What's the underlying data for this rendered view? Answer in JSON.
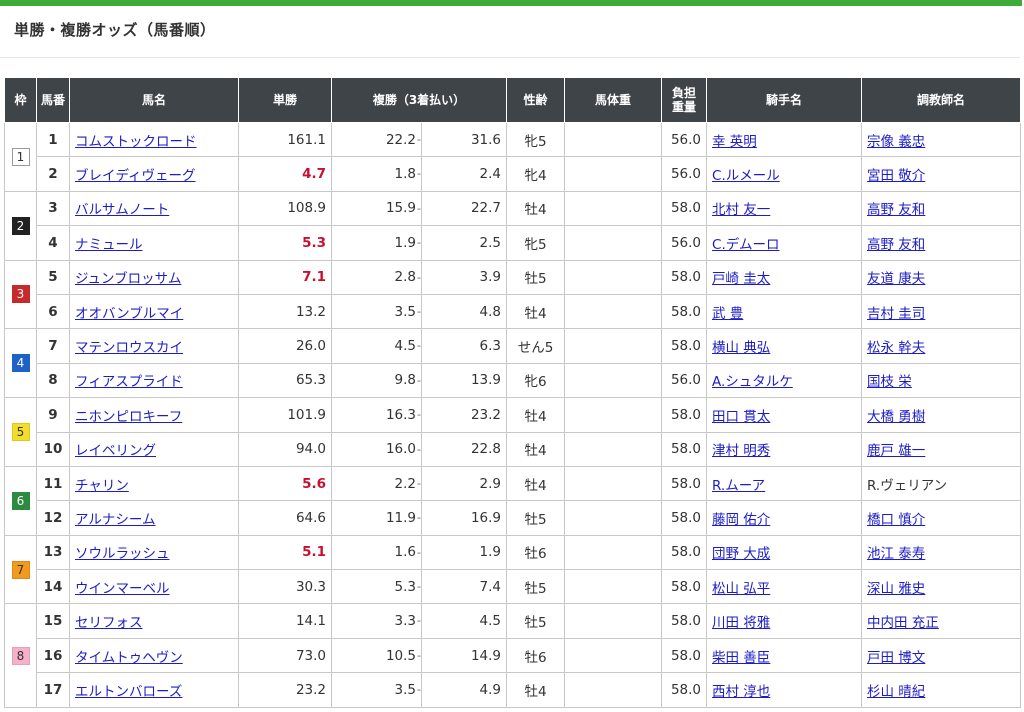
{
  "page": {
    "title": "単勝・複勝オッズ（馬番順）"
  },
  "colors": {
    "accent": "#3daa3a",
    "header_bg": "#3e4448",
    "link": "#1c1cc8",
    "popular": "#c8102e"
  },
  "headers": {
    "waku": "枠",
    "umaban": "馬番",
    "name": "馬名",
    "win": "単勝",
    "place": "複勝（3着払い）",
    "sex_age": "性齢",
    "body_weight": "馬体重",
    "carried_weight": "負担 重量",
    "jockey": "騎手名",
    "trainer": "調教師名"
  },
  "waku": [
    {
      "label": "1",
      "bg": "#ffffff",
      "fg": "#333333",
      "border": "#999999"
    },
    {
      "label": "2",
      "bg": "#222222",
      "fg": "#ffffff",
      "border": "#222222"
    },
    {
      "label": "3",
      "bg": "#c62a2a",
      "fg": "#ffffff",
      "border": "#c62a2a"
    },
    {
      "label": "4",
      "bg": "#1e62c8",
      "fg": "#ffffff",
      "border": "#1e62c8"
    },
    {
      "label": "5",
      "bg": "#f2dd2a",
      "fg": "#333333",
      "border": "#e0c820"
    },
    {
      "label": "6",
      "bg": "#2e8a3e",
      "fg": "#ffffff",
      "border": "#2e8a3e"
    },
    {
      "label": "7",
      "bg": "#f29a1e",
      "fg": "#333333",
      "border": "#e08a10"
    },
    {
      "label": "8",
      "bg": "#f6b0c8",
      "fg": "#333333",
      "border": "#e8a0b8"
    }
  ],
  "sep": "-",
  "horses": [
    {
      "waku": 1,
      "num": "1",
      "name": "コムストックロード",
      "win": "161.1",
      "popular": false,
      "place_lo": "22.2",
      "place_hi": "31.6",
      "sex_age": "牝5",
      "body_weight": "",
      "weight": "56.0",
      "jockey": "幸 英明",
      "trainer": "宗像 義忠",
      "trainer_link": true
    },
    {
      "waku": 1,
      "num": "2",
      "name": "ブレイディヴェーグ",
      "win": "4.7",
      "popular": true,
      "place_lo": "1.8",
      "place_hi": "2.4",
      "sex_age": "牝4",
      "body_weight": "",
      "weight": "56.0",
      "jockey": "C.ルメール",
      "trainer": "宮田 敬介",
      "trainer_link": true
    },
    {
      "waku": 2,
      "num": "3",
      "name": "バルサムノート",
      "win": "108.9",
      "popular": false,
      "place_lo": "15.9",
      "place_hi": "22.7",
      "sex_age": "牡4",
      "body_weight": "",
      "weight": "58.0",
      "jockey": "北村 友一",
      "trainer": "高野 友和",
      "trainer_link": true
    },
    {
      "waku": 2,
      "num": "4",
      "name": "ナミュール",
      "win": "5.3",
      "popular": true,
      "place_lo": "1.9",
      "place_hi": "2.5",
      "sex_age": "牝5",
      "body_weight": "",
      "weight": "56.0",
      "jockey": "C.デムーロ",
      "trainer": "高野 友和",
      "trainer_link": true
    },
    {
      "waku": 3,
      "num": "5",
      "name": "ジュンブロッサム",
      "win": "7.1",
      "popular": true,
      "place_lo": "2.8",
      "place_hi": "3.9",
      "sex_age": "牡5",
      "body_weight": "",
      "weight": "58.0",
      "jockey": "戸崎 圭太",
      "trainer": "友道 康夫",
      "trainer_link": true
    },
    {
      "waku": 3,
      "num": "6",
      "name": "オオバンブルマイ",
      "win": "13.2",
      "popular": false,
      "place_lo": "3.5",
      "place_hi": "4.8",
      "sex_age": "牡4",
      "body_weight": "",
      "weight": "58.0",
      "jockey": "武 豊",
      "trainer": "吉村 圭司",
      "trainer_link": true
    },
    {
      "waku": 4,
      "num": "7",
      "name": "マテンロウスカイ",
      "win": "26.0",
      "popular": false,
      "place_lo": "4.5",
      "place_hi": "6.3",
      "sex_age": "せん5",
      "body_weight": "",
      "weight": "58.0",
      "jockey": "横山 典弘",
      "trainer": "松永 幹夫",
      "trainer_link": true
    },
    {
      "waku": 4,
      "num": "8",
      "name": "フィアスプライド",
      "win": "65.3",
      "popular": false,
      "place_lo": "9.8",
      "place_hi": "13.9",
      "sex_age": "牝6",
      "body_weight": "",
      "weight": "56.0",
      "jockey": "A.シュタルケ",
      "trainer": "国枝 栄",
      "trainer_link": true
    },
    {
      "waku": 5,
      "num": "9",
      "name": "ニホンピロキーフ",
      "win": "101.9",
      "popular": false,
      "place_lo": "16.3",
      "place_hi": "23.2",
      "sex_age": "牡4",
      "body_weight": "",
      "weight": "58.0",
      "jockey": "田口 貫太",
      "trainer": "大橋 勇樹",
      "trainer_link": true
    },
    {
      "waku": 5,
      "num": "10",
      "name": "レイベリング",
      "win": "94.0",
      "popular": false,
      "place_lo": "16.0",
      "place_hi": "22.8",
      "sex_age": "牡4",
      "body_weight": "",
      "weight": "58.0",
      "jockey": "津村 明秀",
      "trainer": "鹿戸 雄一",
      "trainer_link": true
    },
    {
      "waku": 6,
      "num": "11",
      "name": "チャリン",
      "win": "5.6",
      "popular": true,
      "place_lo": "2.2",
      "place_hi": "2.9",
      "sex_age": "牡4",
      "body_weight": "",
      "weight": "58.0",
      "jockey": "R.ムーア",
      "trainer": "R.ヴェリアン",
      "trainer_link": false
    },
    {
      "waku": 6,
      "num": "12",
      "name": "アルナシーム",
      "win": "64.6",
      "popular": false,
      "place_lo": "11.9",
      "place_hi": "16.9",
      "sex_age": "牡5",
      "body_weight": "",
      "weight": "58.0",
      "jockey": "藤岡 佑介",
      "trainer": "橋口 慎介",
      "trainer_link": true
    },
    {
      "waku": 7,
      "num": "13",
      "name": "ソウルラッシュ",
      "win": "5.1",
      "popular": true,
      "place_lo": "1.6",
      "place_hi": "1.9",
      "sex_age": "牡6",
      "body_weight": "",
      "weight": "58.0",
      "jockey": "団野 大成",
      "trainer": "池江 泰寿",
      "trainer_link": true
    },
    {
      "waku": 7,
      "num": "14",
      "name": "ウインマーベル",
      "win": "30.3",
      "popular": false,
      "place_lo": "5.3",
      "place_hi": "7.4",
      "sex_age": "牡5",
      "body_weight": "",
      "weight": "58.0",
      "jockey": "松山 弘平",
      "trainer": "深山 雅史",
      "trainer_link": true
    },
    {
      "waku": 8,
      "num": "15",
      "name": "セリフォス",
      "win": "14.1",
      "popular": false,
      "place_lo": "3.3",
      "place_hi": "4.5",
      "sex_age": "牡5",
      "body_weight": "",
      "weight": "58.0",
      "jockey": "川田 将雅",
      "trainer": "中内田 充正",
      "trainer_link": true
    },
    {
      "waku": 8,
      "num": "16",
      "name": "タイムトゥヘヴン",
      "win": "73.0",
      "popular": false,
      "place_lo": "10.5",
      "place_hi": "14.9",
      "sex_age": "牡6",
      "body_weight": "",
      "weight": "58.0",
      "jockey": "柴田 善臣",
      "trainer": "戸田 博文",
      "trainer_link": true
    },
    {
      "waku": 8,
      "num": "17",
      "name": "エルトンバローズ",
      "win": "23.2",
      "popular": false,
      "place_lo": "3.5",
      "place_hi": "4.9",
      "sex_age": "牡4",
      "body_weight": "",
      "weight": "58.0",
      "jockey": "西村 淳也",
      "trainer": "杉山 晴紀",
      "trainer_link": true
    }
  ]
}
